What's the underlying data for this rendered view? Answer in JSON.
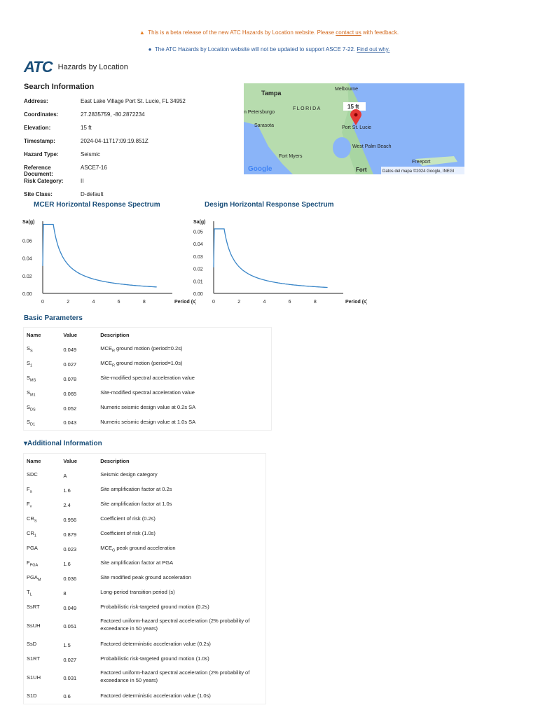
{
  "banners": {
    "beta_pre": "This is a beta release of the new ATC Hazards by Location website. Please ",
    "beta_link": "contact us",
    "beta_post": " with feedback.",
    "info_text": "The ATC Hazards by Location website will not be updated to support ASCE 7-22. ",
    "info_link": "Find out why."
  },
  "header": {
    "logo": "ATC",
    "title": "Hazards by Location"
  },
  "search": {
    "title": "Search Information",
    "rows": [
      {
        "k": "Address:",
        "v": "East Lake Village Port St. Lucie, FL 34952"
      },
      {
        "k": "Coordinates:",
        "v": "27.2835759, -80.2872234"
      },
      {
        "k": "Elevation:",
        "v": "15 ft"
      },
      {
        "k": "Timestamp:",
        "v": "2024-04-11T17:09:19.851Z"
      },
      {
        "k": "Hazard Type:",
        "v": "Seismic"
      },
      {
        "k": "Reference Document:",
        "v": "ASCE7-16"
      },
      {
        "k": "Risk Category:",
        "v": "II"
      },
      {
        "k": "Site Class:",
        "v": "D-default"
      }
    ]
  },
  "map": {
    "labels": [
      "Tampa",
      "FLORIDA",
      "Melbourne",
      "n Petersburgo",
      "Sarasota",
      "Port St. Lucie",
      "West Palm Beach",
      "Fort Myers",
      "Freeport",
      "Fort"
    ],
    "marker": "15 ft",
    "google": "Google",
    "attribution": "Datos del mapa ©2024 Google, INEGI",
    "colors": {
      "water": "#8ab4f8",
      "land": "#a8d5a2",
      "marker": "#e53935"
    }
  },
  "chart_data": [
    {
      "type": "line",
      "title": "MCER Horizontal Response Spectrum",
      "ylabel": "Sa(g)",
      "xlabel": "Period (s)",
      "xlim": [
        0,
        9
      ],
      "ylim": [
        0,
        0.08
      ],
      "xticks": [
        0,
        2,
        4,
        6,
        8
      ],
      "yticks": [
        "0.00",
        "0.02",
        "0.04",
        "0.06"
      ],
      "SDS": 0.078,
      "SD1": 0.065,
      "T0_start": 0.031,
      "color": "#3a86c8"
    },
    {
      "type": "line",
      "title": "Design Horizontal Response Spectrum",
      "ylabel": "Sa(g)",
      "xlabel": "Period (s)",
      "xlim": [
        0,
        9
      ],
      "ylim": [
        0,
        0.057
      ],
      "xticks": [
        0,
        2,
        4,
        6,
        8
      ],
      "yticks": [
        "0.00",
        "0.01",
        "0.02",
        "0.03",
        "0.04",
        "0.05"
      ],
      "SDS": 0.052,
      "SD1": 0.043,
      "T0_start": 0.021,
      "color": "#3a86c8"
    }
  ],
  "basic": {
    "title": "Basic Parameters",
    "headers": [
      "Name",
      "Value",
      "Description"
    ],
    "rows": [
      {
        "n": "S",
        "s": "S",
        "v": "0.049",
        "d": "MCE",
        "ds": "R",
        "dp": " ground motion (period=0.2s)"
      },
      {
        "n": "S",
        "s": "1",
        "v": "0.027",
        "d": "MCE",
        "ds": "R",
        "dp": " ground motion (period=1.0s)"
      },
      {
        "n": "S",
        "s": "MS",
        "v": "0.078",
        "d": "Site-modified spectral acceleration value",
        "ds": "",
        "dp": ""
      },
      {
        "n": "S",
        "s": "M1",
        "v": "0.065",
        "d": "Site-modified spectral acceleration value",
        "ds": "",
        "dp": ""
      },
      {
        "n": "S",
        "s": "DS",
        "v": "0.052",
        "d": "Numeric seismic design value at 0.2s SA",
        "ds": "",
        "dp": ""
      },
      {
        "n": "S",
        "s": "D1",
        "v": "0.043",
        "d": "Numeric seismic design value at 1.0s SA",
        "ds": "",
        "dp": ""
      }
    ]
  },
  "additional": {
    "title": "▾Additional Information",
    "headers": [
      "Name",
      "Value",
      "Description"
    ],
    "rows": [
      {
        "n": "SDC",
        "s": "",
        "v": "A",
        "d": "Seismic design category",
        "ds": "",
        "dp": ""
      },
      {
        "n": "F",
        "s": "a",
        "v": "1.6",
        "d": "Site amplification factor at 0.2s",
        "ds": "",
        "dp": ""
      },
      {
        "n": "F",
        "s": "v",
        "v": "2.4",
        "d": "Site amplification factor at 1.0s",
        "ds": "",
        "dp": ""
      },
      {
        "n": "CR",
        "s": "S",
        "v": "0.956",
        "d": "Coefficient of risk (0.2s)",
        "ds": "",
        "dp": ""
      },
      {
        "n": "CR",
        "s": "1",
        "v": "0.879",
        "d": "Coefficient of risk (1.0s)",
        "ds": "",
        "dp": ""
      },
      {
        "n": "PGA",
        "s": "",
        "v": "0.023",
        "d": "MCE",
        "ds": "G",
        "dp": " peak ground acceleration"
      },
      {
        "n": "F",
        "s": "PGA",
        "v": "1.6",
        "d": "Site amplification factor at PGA",
        "ds": "",
        "dp": ""
      },
      {
        "n": "PGA",
        "s": "M",
        "v": "0.036",
        "d": "Site modified peak ground acceleration",
        "ds": "",
        "dp": ""
      },
      {
        "n": "T",
        "s": "L",
        "v": "8",
        "d": "Long-period transition period (s)",
        "ds": "",
        "dp": ""
      },
      {
        "n": "SsRT",
        "s": "",
        "v": "0.049",
        "d": "Probabilistic risk-targeted ground motion (0.2s)",
        "ds": "",
        "dp": ""
      },
      {
        "n": "SsUH",
        "s": "",
        "v": "0.051",
        "d": "Factored uniform-hazard spectral acceleration (2% probability of exceedance in 50 years)",
        "ds": "",
        "dp": ""
      },
      {
        "n": "SsD",
        "s": "",
        "v": "1.5",
        "d": "Factored deterministic acceleration value (0.2s)",
        "ds": "",
        "dp": ""
      },
      {
        "n": "S1RT",
        "s": "",
        "v": "0.027",
        "d": "Probabilistic risk-targeted ground motion (1.0s)",
        "ds": "",
        "dp": ""
      },
      {
        "n": "S1UH",
        "s": "",
        "v": "0.031",
        "d": "Factored uniform-hazard spectral acceleration (2% probability of exceedance in 50 years)",
        "ds": "",
        "dp": ""
      },
      {
        "n": "S1D",
        "s": "",
        "v": "0.6",
        "d": "Factored deterministic acceleration value (1.0s)",
        "ds": "",
        "dp": ""
      }
    ]
  }
}
